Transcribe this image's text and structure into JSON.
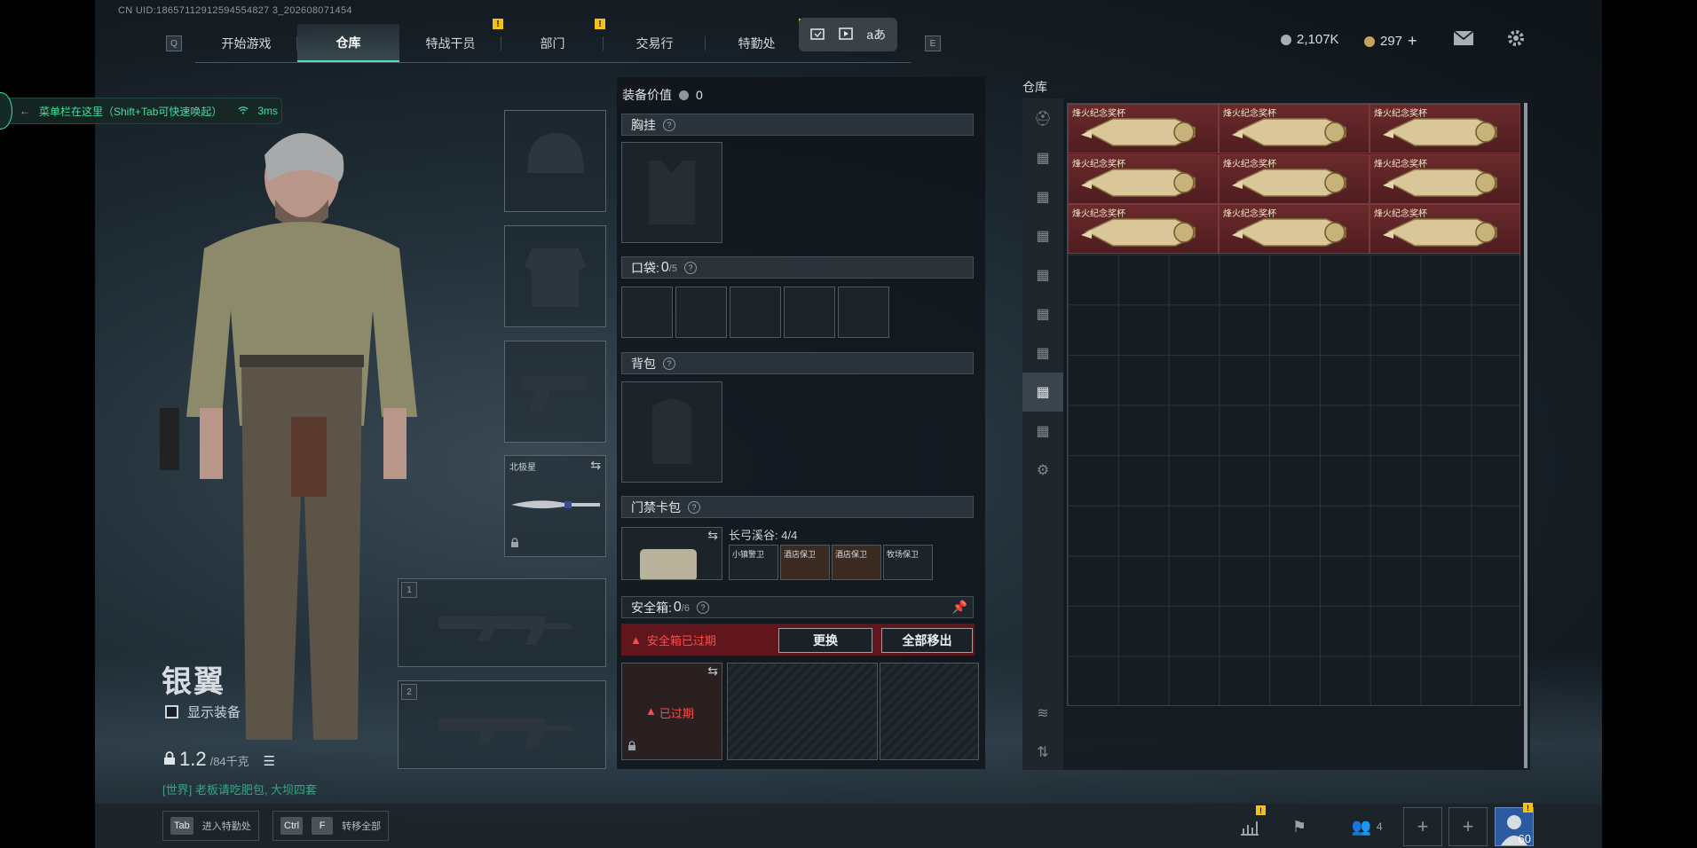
{
  "uid": "CN UID:18657112912594554827 3_202608071454",
  "nav": {
    "left_key": "Q",
    "right_key": "E",
    "tabs": [
      {
        "label": "开始游戏",
        "alert": false
      },
      {
        "label": "仓库",
        "alert": false,
        "active": true
      },
      {
        "label": "特战干员",
        "alert": true
      },
      {
        "label": "部门",
        "alert": true
      },
      {
        "label": "交易行",
        "alert": false
      },
      {
        "label": "特勤处",
        "alert": true
      }
    ],
    "alert_mark": "!"
  },
  "float_toolbar": {
    "icons": [
      "screenshot-icon",
      "record-icon",
      "translate-icon"
    ],
    "translate_glyph": "aあ"
  },
  "currency": {
    "silver": "2,107K",
    "gold": "297",
    "add": "+",
    "silver_color": "#a8b0b6",
    "gold_color": "#c9a15a"
  },
  "menu_hint": {
    "text": "菜单栏在这里（Shift+Tab可快速唤起）",
    "ping": "3ms"
  },
  "character": {
    "name": "银翼",
    "show_gear": "显示装备",
    "weight_value": "1.2",
    "weight_max": "/84千克",
    "chat": "[世界] 老板请吃肥包, 大坝四套"
  },
  "slots": {
    "melee_label": "北极星",
    "weapon1": "1",
    "weapon2": "2"
  },
  "loadout": {
    "value_label": "装备价值",
    "value": "0",
    "chest_rig": "胸挂",
    "pockets_label": "口袋:",
    "pockets_count": "0",
    "pockets_max": "/5",
    "backpack": "背包",
    "keycard": "门禁卡包",
    "keycard_area": "长弓溪谷: 4/4",
    "keycard_tags": [
      "小镇警卫",
      "酒店保卫",
      "酒店保卫",
      "牧场保卫"
    ],
    "safe_label": "安全箱:",
    "safe_count": "0",
    "safe_max": "/6",
    "safe_warning": "安全箱已过期",
    "replace_btn": "更换",
    "move_all_btn": "全部移出",
    "expired": "已过期"
  },
  "warehouse": {
    "title": "仓库",
    "item_label": "烽火纪念奖杯",
    "item_count": 9,
    "accent": "#6a2a2c"
  },
  "bottom": {
    "hint1_key": "Tab",
    "hint1_text": "进入特勤处",
    "hint2_key1": "Ctrl",
    "hint2_key2": "F",
    "hint2_text": "转移全部",
    "squad_count": "4",
    "level": "60"
  }
}
